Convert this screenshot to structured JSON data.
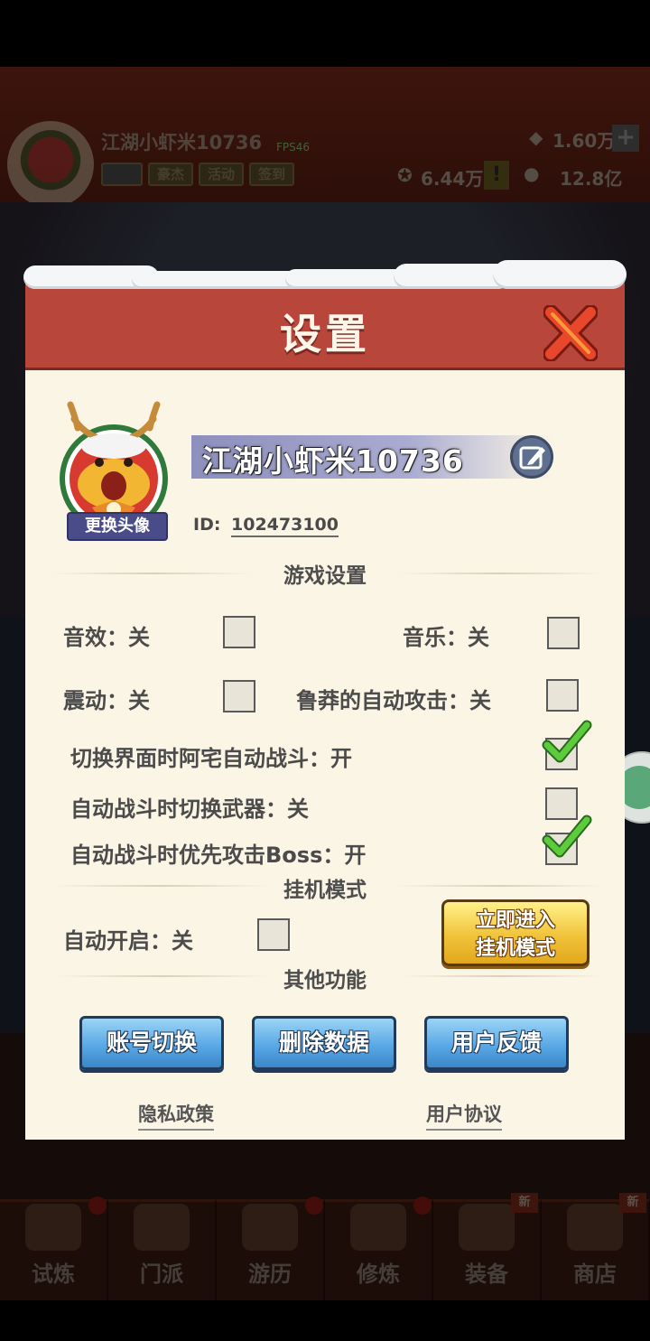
{
  "background": {
    "player_name": "江湖小虾米10736",
    "fps": "FPS46",
    "badges": [
      "豪杰",
      "活动",
      "签到"
    ],
    "gems": "1.60万",
    "power": "6.44万",
    "gold": "12.8亿",
    "bottom_nav": [
      {
        "label": "试炼",
        "dot": true,
        "new": ""
      },
      {
        "label": "门派",
        "dot": false,
        "new": ""
      },
      {
        "label": "游历",
        "dot": true,
        "new": ""
      },
      {
        "label": "修炼",
        "dot": true,
        "new": ""
      },
      {
        "label": "装备",
        "dot": false,
        "new": "新"
      },
      {
        "label": "商店",
        "dot": false,
        "new": "新"
      }
    ]
  },
  "dialog": {
    "title": "设置",
    "avatar_change_label": "更换头像",
    "player_name": "江湖小虾米10736",
    "id_label": "ID:",
    "id_value": "102473100",
    "game_settings_title": "游戏设置",
    "options": {
      "sound": {
        "label": "音效：关",
        "checked": false
      },
      "music": {
        "label": "音乐：关",
        "checked": false
      },
      "vibration": {
        "label": "震动：关",
        "checked": false
      },
      "reckless_auto_attack": {
        "label": "鲁莽的自动攻击：关",
        "checked": false
      },
      "auto_battle_on_switch": {
        "label": "切换界面时阿宅自动战斗：开",
        "checked": true
      },
      "auto_switch_weapon": {
        "label": "自动战斗时切换武器：关",
        "checked": false
      },
      "prioritize_boss": {
        "label": "自动战斗时优先攻击Boss：开",
        "checked": true
      }
    },
    "idle_mode_title": "挂机模式",
    "auto_start": {
      "label": "自动开启：关",
      "checked": false
    },
    "enter_idle_button": {
      "line1": "立即进入",
      "line2": "挂机模式"
    },
    "other_title": "其他功能",
    "buttons": {
      "switch_account": "账号切换",
      "delete_data": "删除数据",
      "feedback": "用户反馈"
    },
    "links": {
      "privacy": "隐私政策",
      "agreement": "用户协议"
    }
  },
  "colors": {
    "header_red": "#b8463a",
    "panel_cream": "#fbf5e6",
    "button_blue": "#5aa9e6",
    "button_gold": "#f0c33a",
    "check_green": "#4cbf3a"
  }
}
